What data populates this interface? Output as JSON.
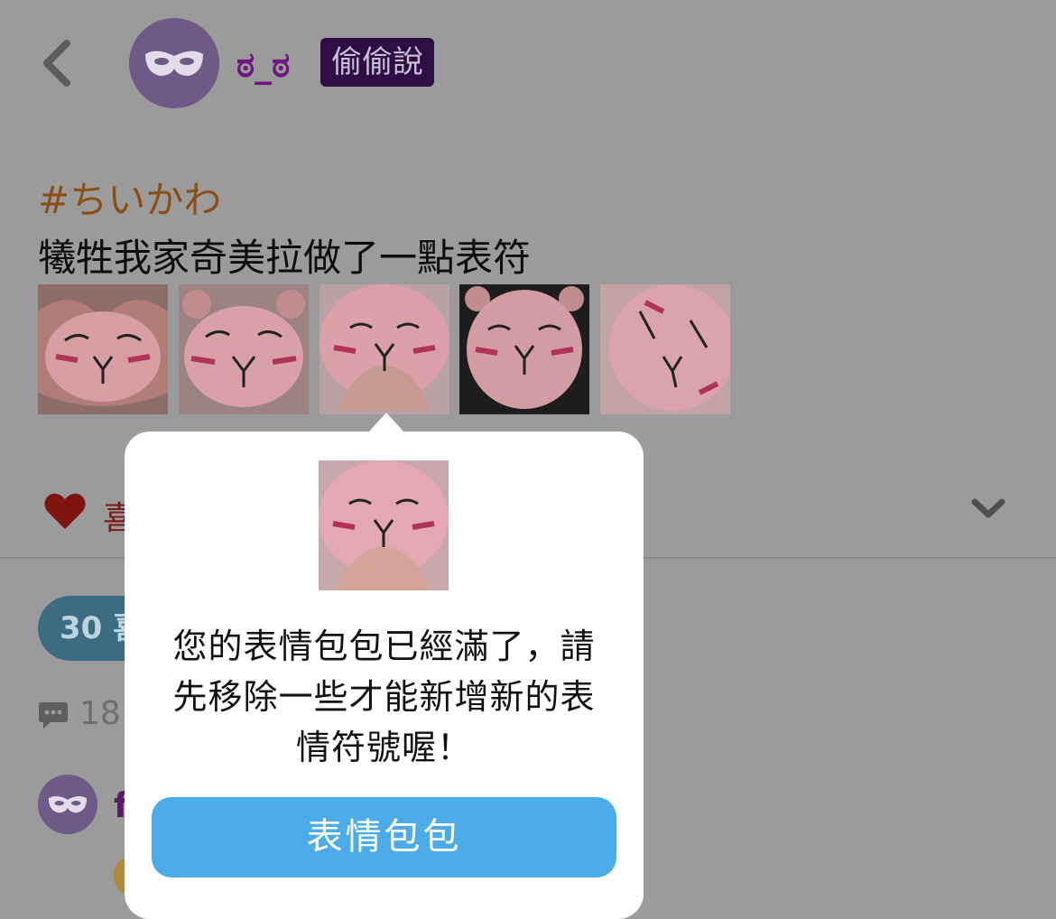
{
  "header": {
    "back_icon": "chevron-left-icon",
    "author": {
      "name": "ಠ_ಠ",
      "avatar_icon": "mask-icon",
      "avatar_color": "#6d5a86"
    },
    "badge": "偷偷說"
  },
  "post": {
    "hashtag": "#ちいかわ",
    "text": "犧牲我家奇美拉做了一點表符",
    "thumbnails": [
      "sticker-1",
      "sticker-2",
      "sticker-3",
      "sticker-4",
      "sticker-5"
    ]
  },
  "actions": {
    "like_icon": "heart-icon",
    "like_label": "喜",
    "expand_icon": "chevron-down-icon",
    "likes_pill": "30 喜",
    "comment_icon": "speech-bubble-icon",
    "comments": "18"
  },
  "reply": {
    "avatar_icon": "mask-icon",
    "name": "f"
  },
  "popup": {
    "message_lines": [
      "您的表情包包已經滿了，請",
      "先移除一些才能新增新的表",
      "情符號喔！"
    ],
    "button_label": "表情包包",
    "button_color": "#4cacea"
  },
  "colors": {
    "overlay": "#9b9b9b",
    "username": "#6d1580",
    "badge_bg": "#2e0e45",
    "hashtag": "#8a4f15"
  }
}
